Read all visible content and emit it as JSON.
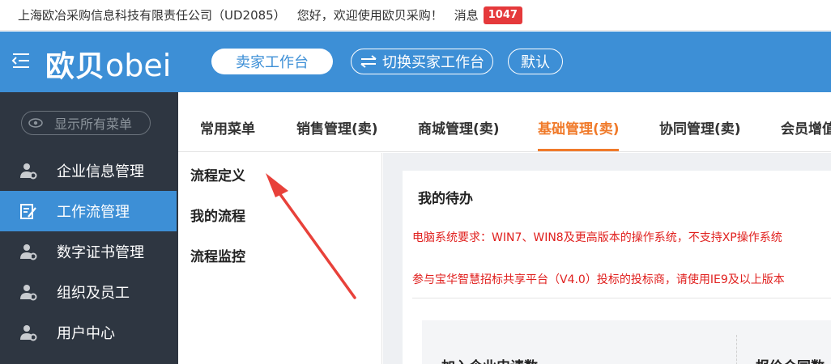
{
  "topbar": {
    "company": "上海欧冶采购信息科技有限责任公司（UD2085）",
    "greeting": "您好，欢迎使用欧贝采购！",
    "messages_label": "消息",
    "messages_count": "1047"
  },
  "header": {
    "logo_cn": "欧贝",
    "logo_latin": "obei",
    "seller_workbench": "卖家工作台",
    "switch_buyer": "切换买家工作台",
    "default": "默认"
  },
  "sidebar": {
    "show_all": "显示所有菜单",
    "items": [
      {
        "label": "企业信息管理",
        "icon": "user-gear-icon"
      },
      {
        "label": "工作流管理",
        "icon": "edit-document-icon"
      },
      {
        "label": "数字证书管理",
        "icon": "user-gear-icon"
      },
      {
        "label": "组织及员工",
        "icon": "user-gear-icon"
      },
      {
        "label": "用户中心",
        "icon": "user-gear-icon"
      }
    ],
    "active_index": 1
  },
  "tabs": [
    "常用菜单",
    "销售管理(卖)",
    "商城管理(卖)",
    "基础管理(卖)",
    "协同管理(卖)",
    "会员增值"
  ],
  "active_tab": "基础管理(卖)",
  "submenu": [
    "流程定义",
    "我的流程",
    "流程监控"
  ],
  "content": {
    "title": "我的待办",
    "notice1": "电脑系统要求：WIN7、WIN8及更高版本的操作系统，不支持XP操作系统",
    "notice2": "参与宝华智慧招标共享平台（V4.0）投标的投标商，请使用IE9及以上版本",
    "card1_title": "加入企业申请数",
    "card2_title": "报价合同数"
  },
  "colors": {
    "header_blue": "#3d8fd6",
    "sidebar_dark": "#2e3641",
    "accent_orange": "#f07a2a",
    "notice_red": "#e0211f",
    "badge_red": "#e5393b"
  }
}
